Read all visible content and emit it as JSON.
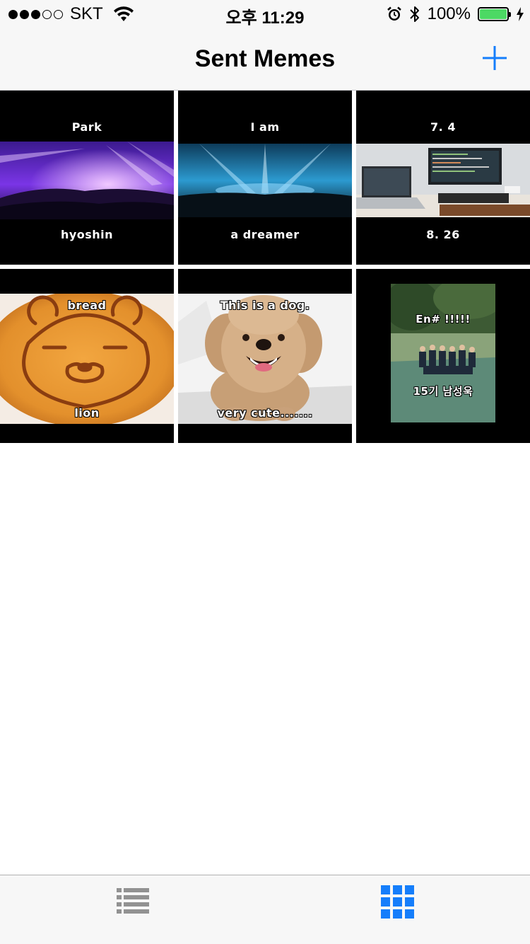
{
  "status_bar": {
    "carrier": "SKT",
    "time": "오후 11:29",
    "battery": "100%"
  },
  "nav": {
    "title": "Sent Memes",
    "add_icon": "plus-icon"
  },
  "memes": [
    {
      "top": "Park",
      "bottom": "hyoshin",
      "image": "purple-concert-photo"
    },
    {
      "top": "I am",
      "bottom": "a dreamer",
      "image": "blue-concert-photo"
    },
    {
      "top": "7. 4",
      "bottom": "8. 26",
      "image": "laptop-desk-photo"
    },
    {
      "top": "bread",
      "bottom": "lion",
      "image": "bear-latte-photo"
    },
    {
      "top": "This is a dog.",
      "bottom": "very cute.......",
      "image": "poodle-photo"
    },
    {
      "top": "En# !!!!!",
      "bottom": "15기 남성욱",
      "image": "group-photo"
    }
  ],
  "tabs": [
    {
      "icon": "list-icon",
      "selected": false
    },
    {
      "icon": "grid-icon",
      "selected": true
    }
  ],
  "colors": {
    "tint": "#157efb",
    "inactive_tab": "#929292",
    "battery": "#4cd964"
  }
}
